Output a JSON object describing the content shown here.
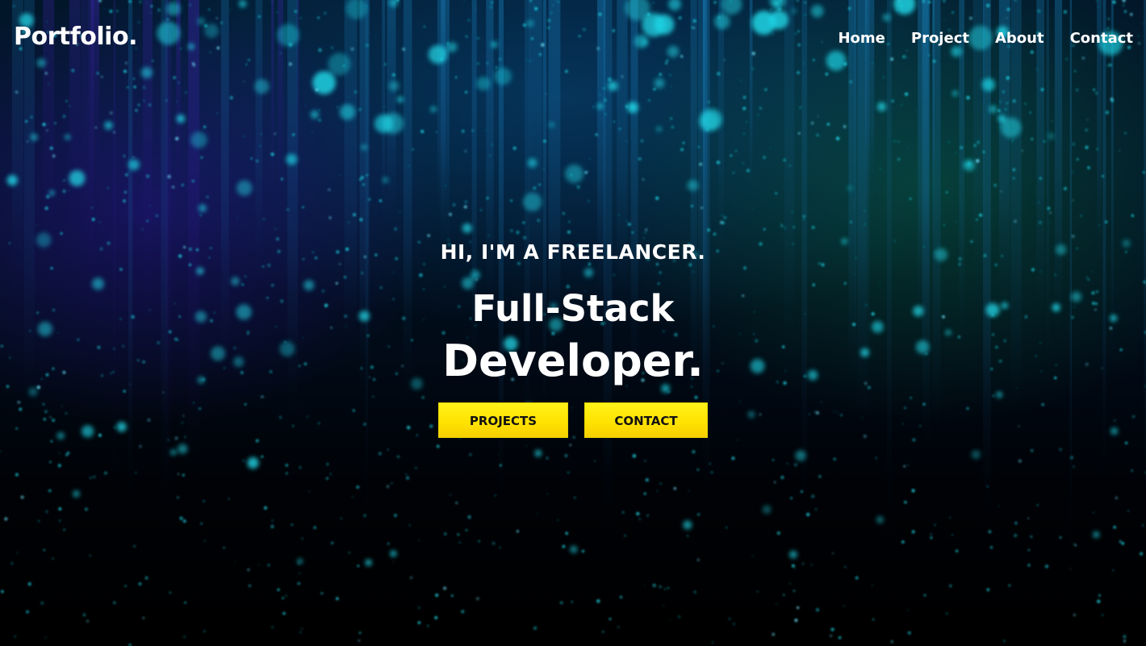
{
  "site": {
    "logo": "Portfolio."
  },
  "nav": {
    "items": [
      {
        "label": "Home"
      },
      {
        "label": "Project"
      },
      {
        "label": "About"
      },
      {
        "label": "Contact"
      }
    ]
  },
  "hero": {
    "intro": "HI, I'M A FREELANCER.",
    "headline_line1": "Full-Stack",
    "headline_line2": "Developer.",
    "buttons": {
      "projects_label": "PROJECTS",
      "contact_label": "CONTACT"
    }
  },
  "colors": {
    "button_yellow": "#ffe600",
    "particle_cyan": "#1fd6e6",
    "text": "#ffffff"
  }
}
